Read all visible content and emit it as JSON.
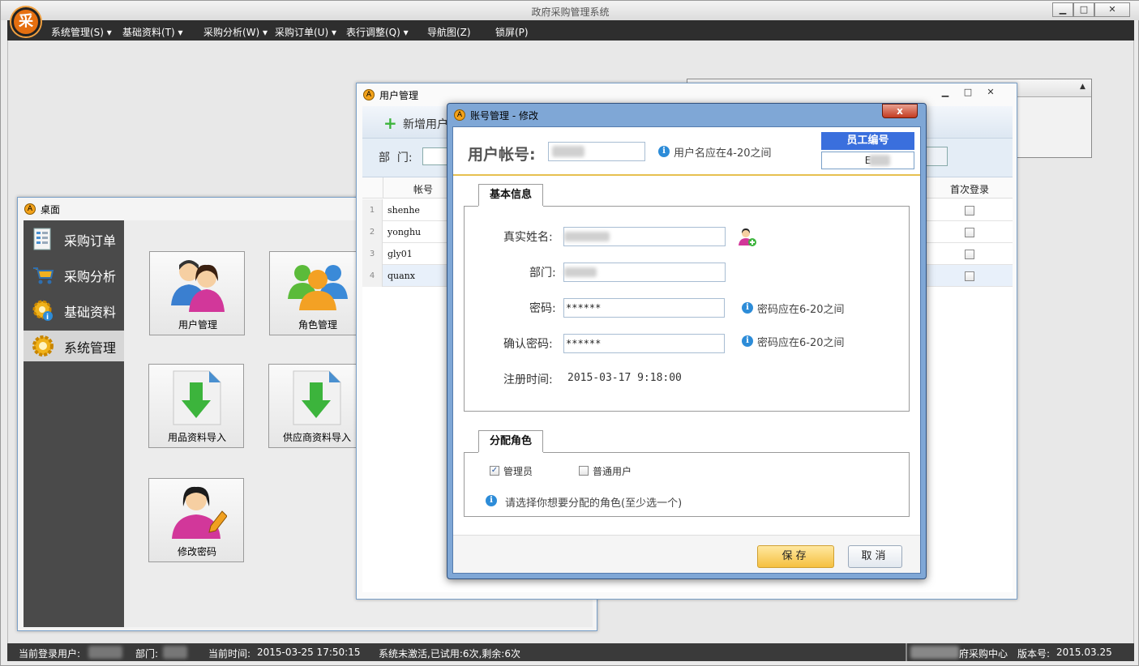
{
  "app": {
    "title": "政府采购管理系统",
    "logo_text": "采",
    "window_buttons": [
      "▁",
      "□",
      "✕"
    ]
  },
  "menu": [
    {
      "label": "系统管理(S)"
    },
    {
      "label": "基础资料(T)"
    },
    {
      "label": "采购分析(W)"
    },
    {
      "label": "采购订单(U)"
    },
    {
      "label": "表行调整(Q)"
    },
    {
      "label": "导航图(Z)"
    },
    {
      "label": "锁屏(P)"
    }
  ],
  "desktop": {
    "title": "桌面",
    "sidebar": [
      {
        "label": "采购订单",
        "icon": "order-sheet-icon"
      },
      {
        "label": "采购分析",
        "icon": "shopping-cart-icon"
      },
      {
        "label": "基础资料",
        "icon": "gear-info-icon"
      },
      {
        "label": "系统管理",
        "icon": "gear-icon"
      }
    ],
    "tiles": [
      {
        "label": "用户管理",
        "icon": "users-icon"
      },
      {
        "label": "角色管理",
        "icon": "roles-icon"
      },
      {
        "label": "用品资料导入",
        "icon": "import-down-icon"
      },
      {
        "label": "供应商资料导入",
        "icon": "import-down-icon"
      },
      {
        "label": "修改密码",
        "icon": "user-edit-icon"
      }
    ]
  },
  "user_mgmt": {
    "title": "用户管理",
    "toolbar_add": "新增用户",
    "filter_dept_label": "部  门:",
    "col_account": "帐号",
    "col_first_login": "首次登录",
    "rows": [
      {
        "num": "1",
        "account": "shenhe"
      },
      {
        "num": "2",
        "account": "yonghu"
      },
      {
        "num": "3",
        "account": "gly01"
      },
      {
        "num": "4",
        "account": "quanx"
      }
    ]
  },
  "edit_dialog": {
    "title": "账号管理 - 修改",
    "account_label": "用户帐号:",
    "account_hint": "用户名应在4-20之间",
    "employee_no_header": "员工编号",
    "employee_no_value": "E",
    "tab_basic": "基本信息",
    "realname_label": "真实姓名:",
    "dept_label": "部门:",
    "password_label": "密码:",
    "password_value": "******",
    "password_hint": "密码应在6-20之间",
    "confirm_label": "确认密码:",
    "confirm_value": "******",
    "confirm_hint": "密码应在6-20之间",
    "register_time_label": "注册时间:",
    "register_time_value": "2015-03-17 9:18:00",
    "tab_roles": "分配角色",
    "role_admin": "管理员",
    "role_admin_checked": true,
    "role_user": "普通用户",
    "role_user_checked": false,
    "roles_hint": "请选择你想要分配的角色(至少选一个)",
    "save_label": "保存",
    "cancel_label": "取消",
    "close_label": "x"
  },
  "status": {
    "current_user_label": "当前登录用户:",
    "dept_label": "部门:",
    "time_label": "当前时间:",
    "time_value": "2015-03-25 17:50:15",
    "activation": "系统未激活,已试用:6次,剩余:6次",
    "center": "府采购中心",
    "version_label": "版本号:",
    "version_value": "2015.03.25"
  }
}
